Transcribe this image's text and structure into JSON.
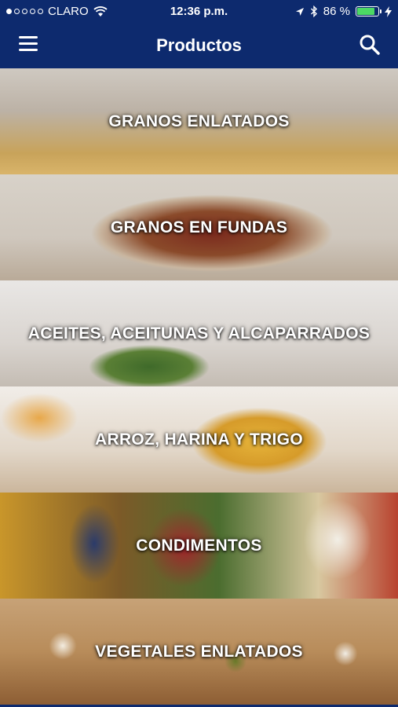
{
  "status_bar": {
    "carrier": "CLARO",
    "time": "12:36 p.m.",
    "battery_percent": "86 %",
    "battery_level": 0.86,
    "icons": [
      "signal-dots-icon",
      "wifi-icon",
      "location-arrow-icon",
      "bluetooth-icon",
      "battery-icon",
      "charging-bolt-icon"
    ]
  },
  "nav": {
    "title": "Productos",
    "menu_icon": "hamburger-menu-icon",
    "search_icon": "search-icon"
  },
  "categories": [
    {
      "label": "GRANOS ENLATADOS"
    },
    {
      "label": "GRANOS EN FUNDAS"
    },
    {
      "label": "ACEITES, ACEITUNAS Y ALCAPARRADOS"
    },
    {
      "label": "ARROZ, HARINA Y TRIGO"
    },
    {
      "label": "CONDIMENTOS"
    },
    {
      "label": "VEGETALES ENLATADOS"
    }
  ],
  "colors": {
    "brand_navy": "#0d2a6e",
    "battery_green": "#4cd964",
    "label_text": "#ffffff"
  }
}
